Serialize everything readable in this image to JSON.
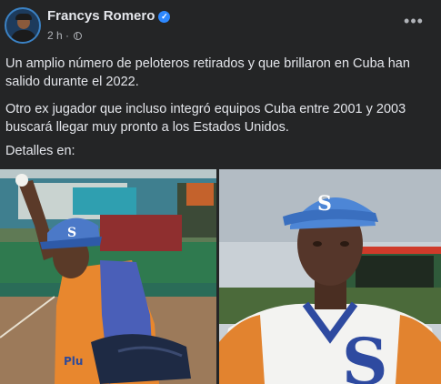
{
  "post": {
    "author": "Francys Romero",
    "time": "2 h",
    "paragraphs": [
      "Un amplio número de peloteros retirados y que brillaron en Cuba han salido durante el 2022.",
      "Otro ex jugador que incluso integró equipos Cuba entre 2001 y 2003 buscará llegar muy pronto a los Estados Unidos.",
      "Detalles en:"
    ]
  },
  "icons": {
    "verified": "verified-badge-icon",
    "audience": "globe-icon",
    "more": "more-options-icon"
  },
  "colors": {
    "background": "#242526",
    "text": "#e4e6eb",
    "secondary_text": "#b0b3b8",
    "verified": "#2d88ff"
  }
}
